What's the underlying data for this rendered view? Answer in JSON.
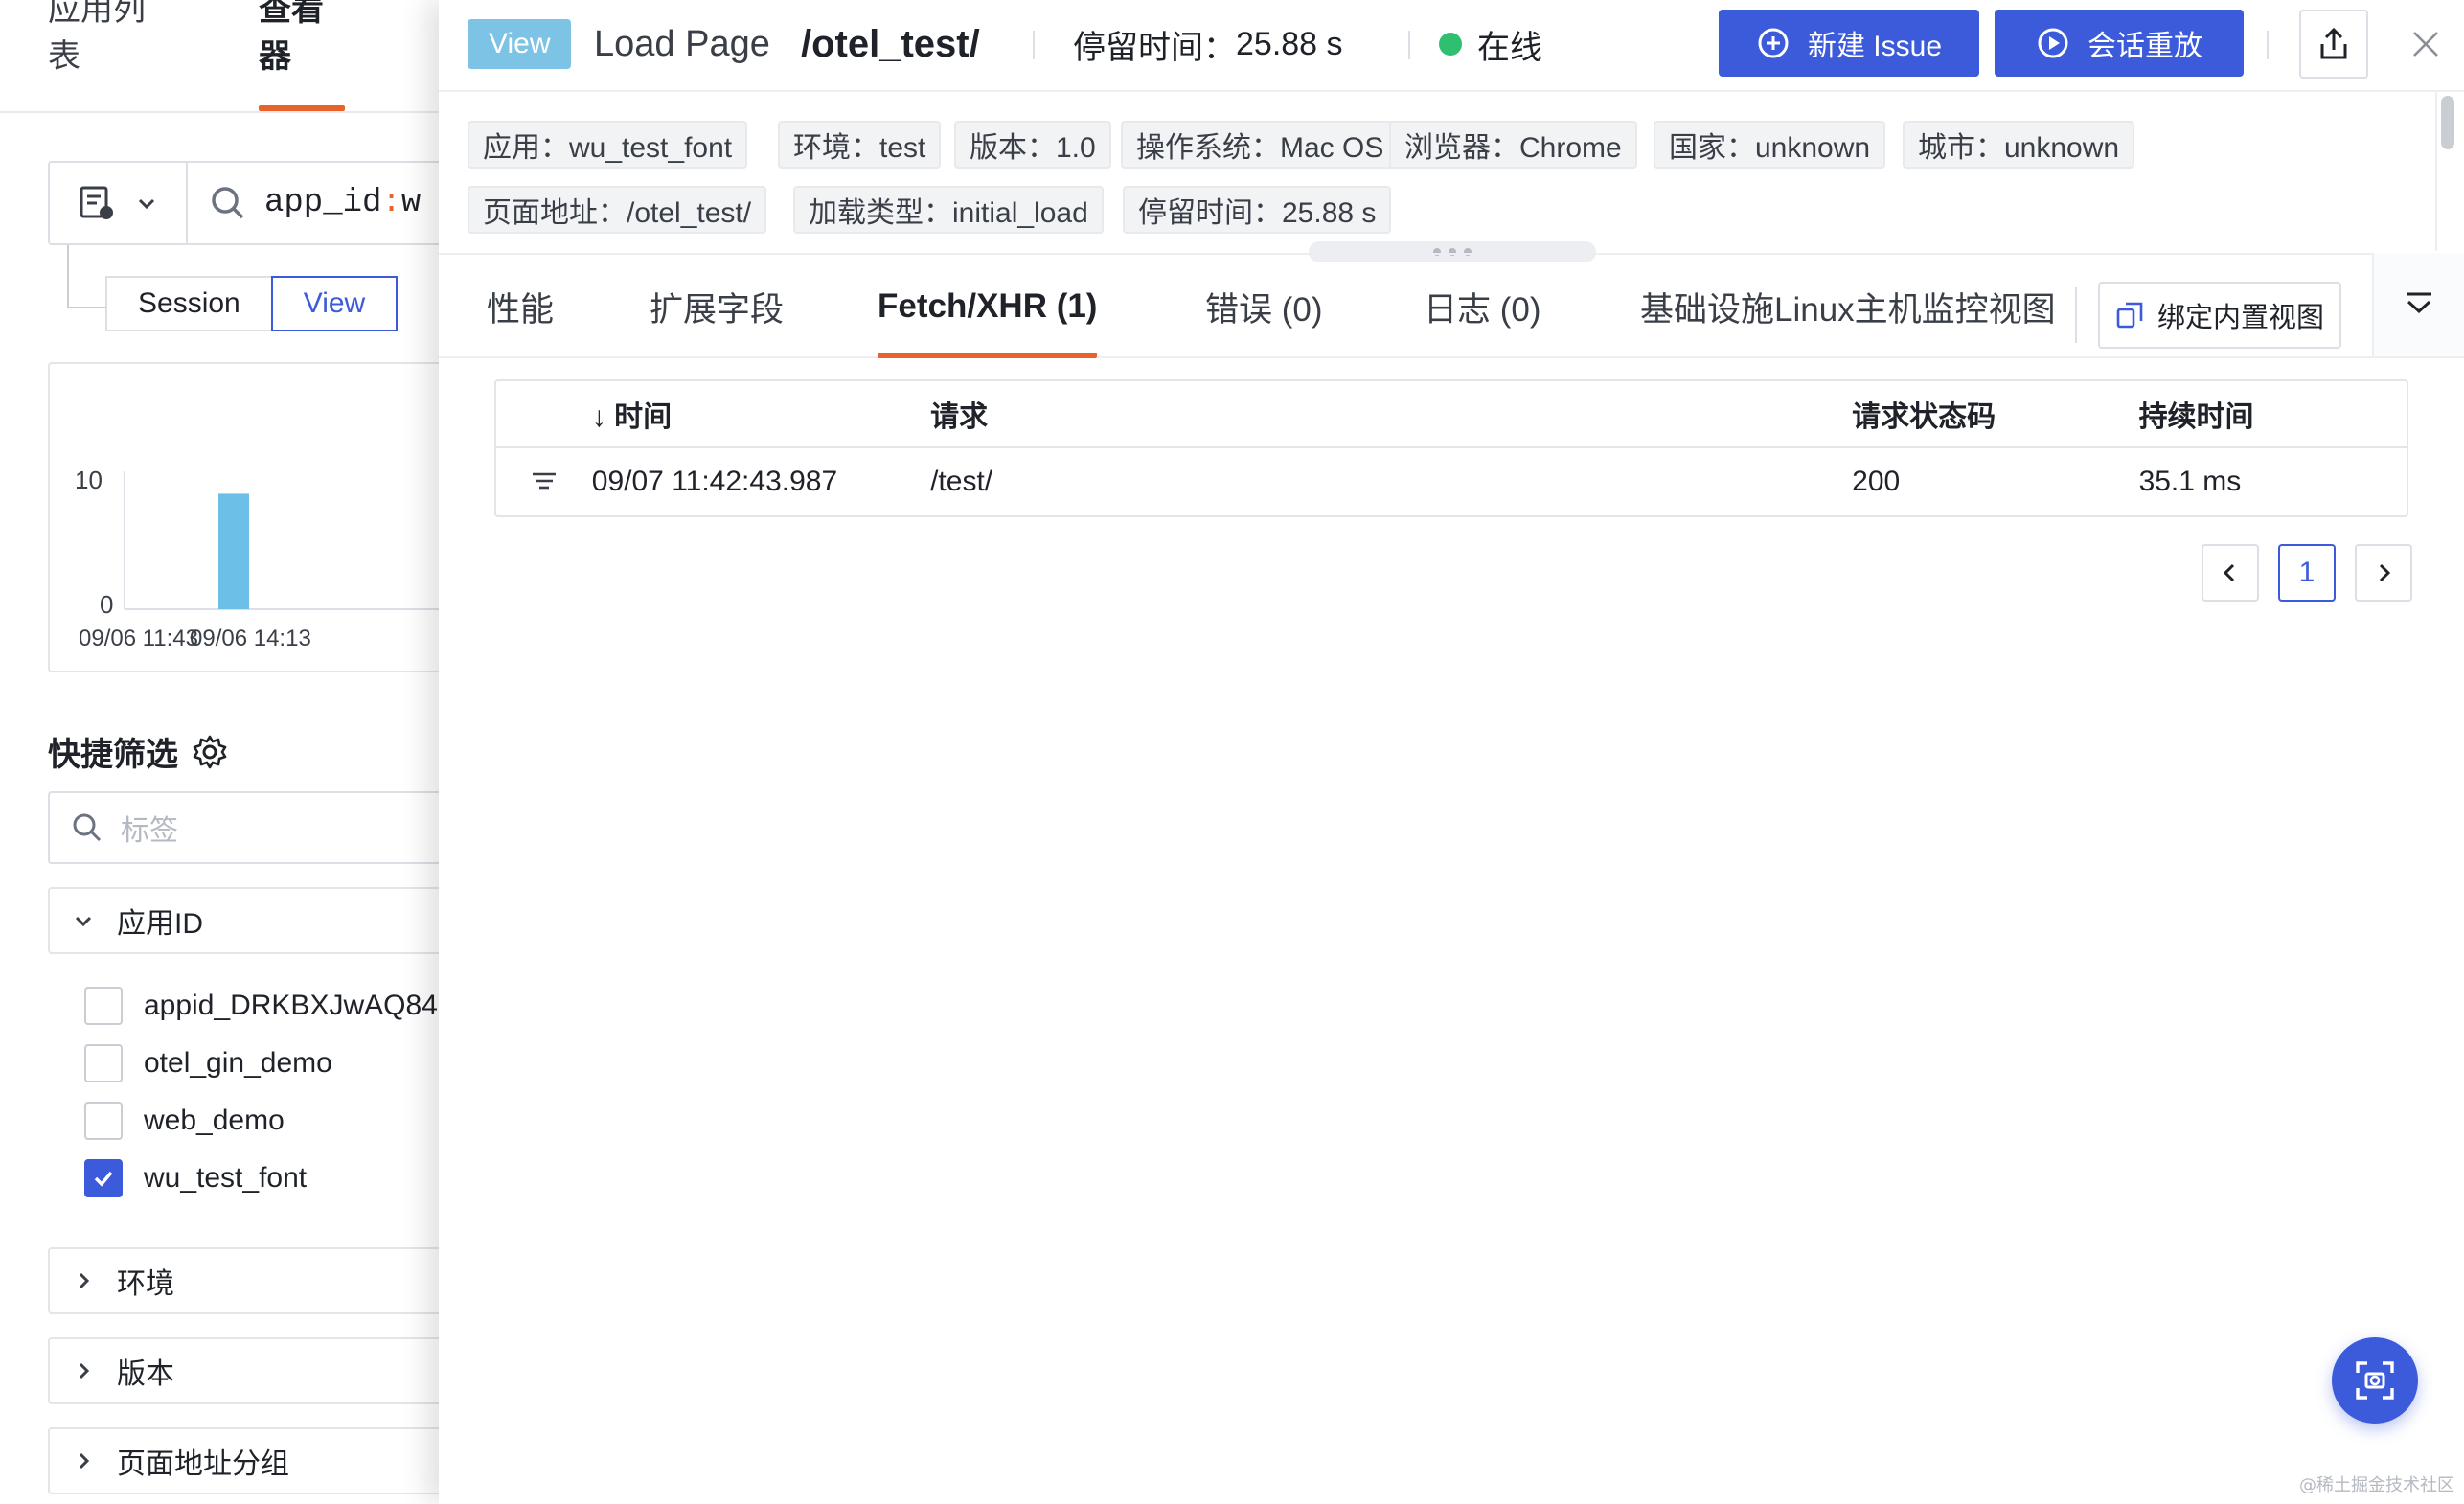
{
  "left": {
    "nav_tabs": [
      "应用列表",
      "查看器"
    ],
    "search": {
      "key": "app_id",
      "colon": ":",
      "value": "w"
    },
    "segments": [
      "Session",
      "View"
    ],
    "chart_data": {
      "type": "bar",
      "y_ticks": [
        "10",
        "0"
      ],
      "x_ticks": [
        "09/06 11:43",
        "09/06 14:13"
      ],
      "ylim": [
        0,
        10
      ],
      "bar_value": 9,
      "bar_color": "#6cbfe6"
    },
    "quick_filter_title": "快捷筛选",
    "tag_placeholder": "标签",
    "app_group": "应用ID",
    "app_options": [
      {
        "label": "appid_DRKBXJwAQ84",
        "checked": false
      },
      {
        "label": "otel_gin_demo",
        "checked": false
      },
      {
        "label": "web_demo",
        "checked": false
      },
      {
        "label": "wu_test_font",
        "checked": true
      }
    ],
    "groups": [
      "环境",
      "版本",
      "页面地址分组"
    ]
  },
  "header": {
    "badge": "View",
    "title_prefix": "Load Page",
    "title_path": "/otel_test/",
    "stay_label": "停留时间：",
    "stay_value": "25.88 s",
    "status": "在线",
    "new_issue": "新建 Issue",
    "replay": "会话重放"
  },
  "tags": [
    "应用：wu_test_font",
    "环境：test",
    "版本：1.0",
    "操作系统：Mac OS",
    "浏览器：Chrome",
    "国家：unknown",
    "城市：unknown",
    "页面地址：/otel_test/",
    "加载类型：initial_load",
    "停留时间：25.88 s"
  ],
  "tabs": [
    "性能",
    "扩展字段",
    "Fetch/XHR (1)",
    "错误 (0)",
    "日志 (0)",
    "基础设施Linux主机监控视图"
  ],
  "bind_view_button": "绑定内置视图",
  "table": {
    "columns": [
      "↓ 时间",
      "请求",
      "请求状态码",
      "持续时间"
    ],
    "rows": [
      {
        "time": "09/07 11:42:43.987",
        "request": "/test/",
        "status": "200",
        "duration": "35.1 ms"
      }
    ]
  },
  "pagination": {
    "current": "1"
  },
  "watermark": "@稀土掘金技术社区",
  "colors": {
    "accent": "#3b5bdb",
    "tab_underline": "#e8622c",
    "online": "#2fbf71",
    "badge": "#7cc3e6"
  }
}
